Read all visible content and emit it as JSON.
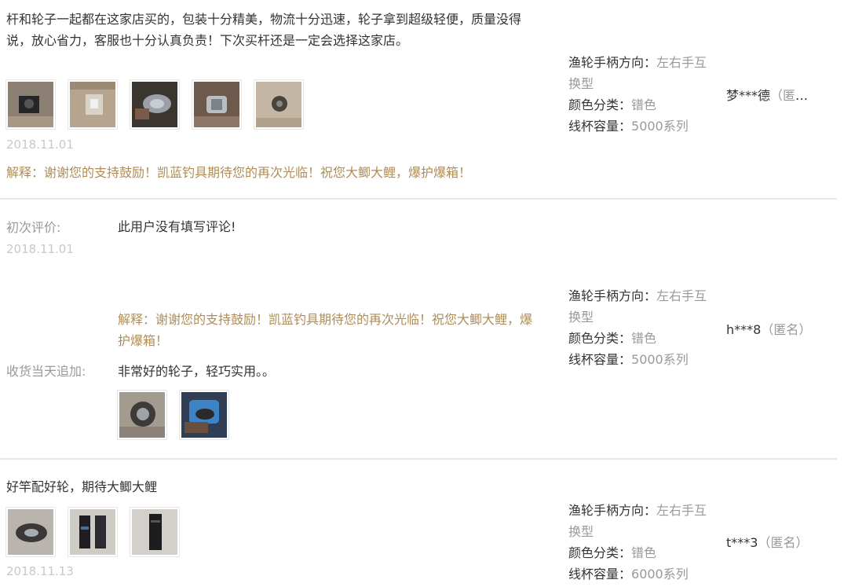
{
  "reviews": [
    {
      "text": "杆和轮子一起都在这家店买的，包装十分精美，物流十分迅速，轮子拿到超级轻便，质量没得说，放心省力，客服也十分认真负责！下次买杆还是一定会选择这家店。",
      "date": "2018.11.01",
      "reply": "解释：谢谢您的支持鼓励！凯蓝钓具期待您的再次光临！祝您大鲫大鲤，爆护爆箱！",
      "photos": [
        "photo-1",
        "photo-2",
        "photo-3",
        "photo-4",
        "photo-5"
      ],
      "sku": {
        "handle_key": "渔轮手柄方向：",
        "handle_val": "左右手互换型",
        "color_key": "颜色分类：",
        "color_val": "镨色",
        "spool_key": "线杯容量：",
        "spool_val": "5000系列"
      },
      "user": "梦***德",
      "anon": "（匿名）"
    },
    {
      "initial_label": "初次评价:",
      "initial_date": "2018.11.01",
      "initial_text": "此用户没有填写评论!",
      "reply": "解释：谢谢您的支持鼓励！凯蓝钓具期待您的再次光临！祝您大鲫大鲤，爆护爆箱！",
      "append_label": "收货当天追加:",
      "append_text": "非常好的轮子，轻巧实用。。",
      "photos": [
        "photo-1",
        "photo-2"
      ],
      "sku": {
        "handle_key": "渔轮手柄方向：",
        "handle_val": "左右手互换型",
        "color_key": "颜色分类：",
        "color_val": "镨色",
        "spool_key": "线杯容量：",
        "spool_val": "5000系列"
      },
      "user": "h***8",
      "anon": "（匿名）"
    },
    {
      "text": "好竿配好轮，期待大鲫大鲤",
      "date": "2018.11.13",
      "photos": [
        "photo-1",
        "photo-2",
        "photo-3"
      ],
      "sku": {
        "handle_key": "渔轮手柄方向：",
        "handle_val": "左右手互换型",
        "color_key": "颜色分类：",
        "color_val": "镨色",
        "spool_key": "线杯容量：",
        "spool_val": "6000系列"
      },
      "user": "t***3",
      "anon": "（匿名）"
    }
  ]
}
